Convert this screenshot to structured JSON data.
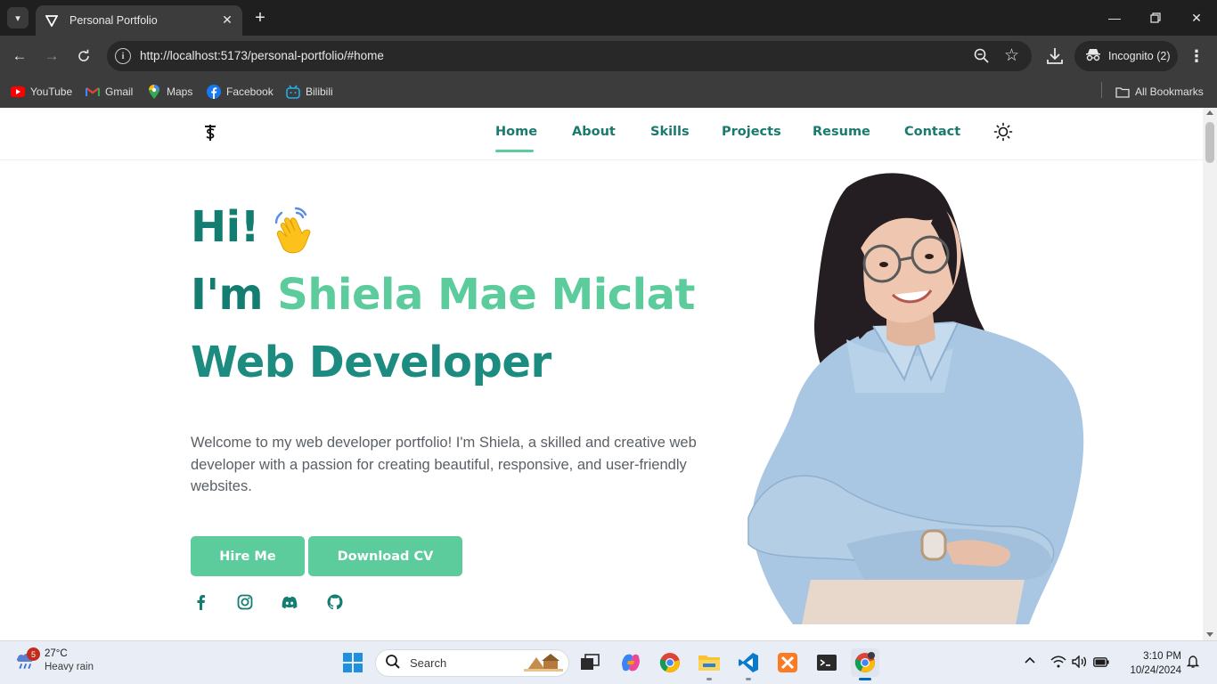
{
  "browser": {
    "tab_title": "Personal Portfolio",
    "url": "http://localhost:5173/personal-portfolio/#home",
    "incognito_label": "Incognito (2)",
    "bookmarks": [
      {
        "label": "YouTube",
        "icon": "youtube-icon"
      },
      {
        "label": "Gmail",
        "icon": "gmail-icon"
      },
      {
        "label": "Maps",
        "icon": "maps-icon"
      },
      {
        "label": "Facebook",
        "icon": "facebook-icon"
      },
      {
        "label": "Bilibili",
        "icon": "bilibili-icon"
      }
    ],
    "all_bookmarks_label": "All Bookmarks"
  },
  "site": {
    "nav": [
      {
        "label": "Home",
        "active": true
      },
      {
        "label": "About",
        "active": false
      },
      {
        "label": "Skills",
        "active": false
      },
      {
        "label": "Projects",
        "active": false
      },
      {
        "label": "Resume",
        "active": false
      },
      {
        "label": "Contact",
        "active": false
      }
    ],
    "hero": {
      "greeting": "Hi!",
      "intro_prefix": "I'm ",
      "name": "Shiela Mae Miclat",
      "role": "Web Developer",
      "description": "Welcome to my web developer portfolio! I'm Shiela, a skilled and creative web developer with a passion for creating beautiful, responsive, and user-friendly websites.",
      "hire_button": "Hire Me",
      "cv_button": "Download CV"
    },
    "socials": [
      "facebook-icon",
      "instagram-icon",
      "discord-icon",
      "github-icon"
    ],
    "colors": {
      "primary": "#137d72",
      "accent": "#5ccc9d",
      "text": "#5a6066"
    }
  },
  "taskbar": {
    "weather_temp": "27°C",
    "weather_desc": "Heavy rain",
    "weather_badge": "5",
    "search_label": "Search",
    "time": "3:10 PM",
    "date": "10/24/2024"
  }
}
